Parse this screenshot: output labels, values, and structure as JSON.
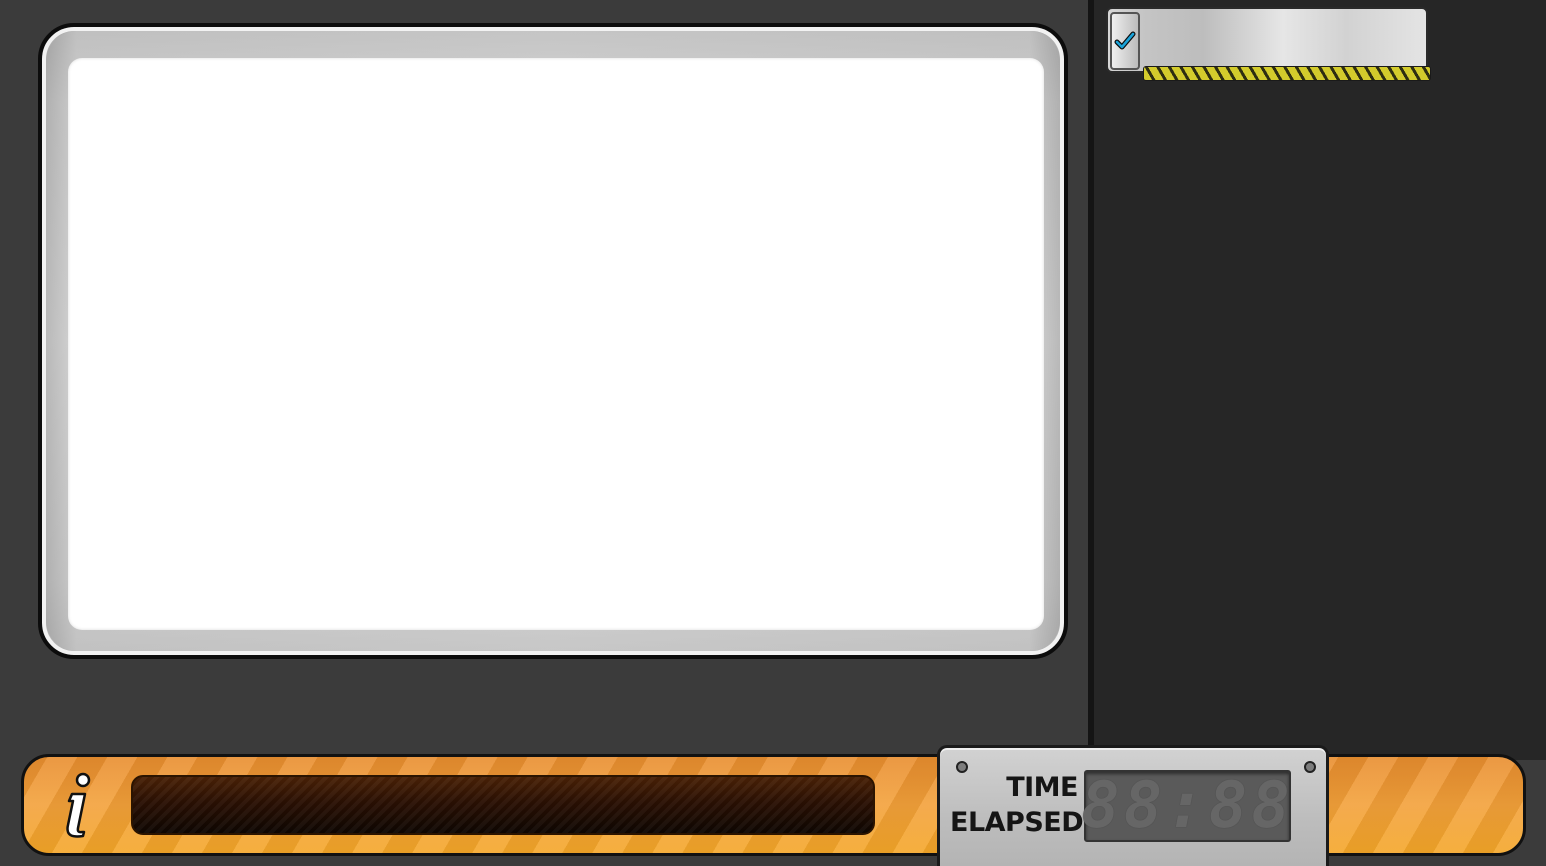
{
  "game": {
    "task_list": [
      {
        "completed": true,
        "progress": 1.0,
        "check_icon": "checkmark-icon"
      }
    ],
    "info_bar": {
      "icon": "info-icon",
      "message": "",
      "accent_color": "#f3a13a"
    },
    "timer": {
      "label_line1": "TIME",
      "label_line2": "ELAPSED",
      "display": "88:88",
      "display_color": "#666666"
    },
    "colors": {
      "background": "#3b3b3b",
      "side_panel": "#262626",
      "screen": "#ffffff",
      "check_color": "#1aa3d9",
      "hazard_stripe": "#c9c12a"
    }
  }
}
